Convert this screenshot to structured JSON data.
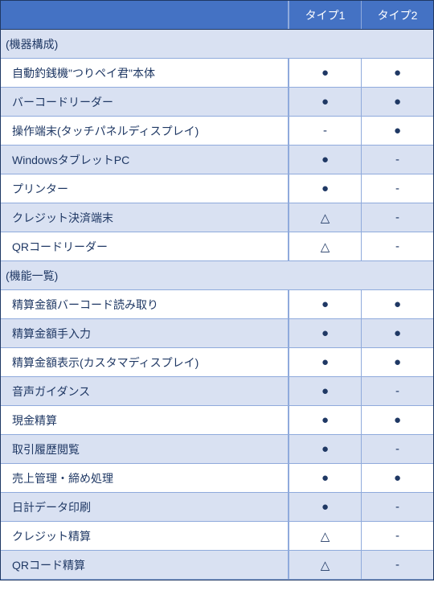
{
  "chart_data": {
    "type": "table",
    "columns": [
      "タイプ1",
      "タイプ2"
    ],
    "sections": [
      {
        "title": "(機器構成)",
        "rows": [
          {
            "label": "自動釣銭機\"つりペイ君\"本体",
            "values": [
              "●",
              "●"
            ]
          },
          {
            "label": "バーコードリーダー",
            "values": [
              "●",
              "●"
            ]
          },
          {
            "label": "操作端末(タッチパネルディスプレイ)",
            "values": [
              "-",
              "●"
            ]
          },
          {
            "label": "WindowsタブレットPC",
            "values": [
              "●",
              "-"
            ]
          },
          {
            "label": "プリンター",
            "values": [
              "●",
              "-"
            ]
          },
          {
            "label": "クレジット決済端末",
            "values": [
              "△",
              "-"
            ]
          },
          {
            "label": "QRコードリーダー",
            "values": [
              "△",
              "-"
            ]
          }
        ]
      },
      {
        "title": "(機能一覧)",
        "rows": [
          {
            "label": "精算金額バーコード読み取り",
            "values": [
              "●",
              "●"
            ]
          },
          {
            "label": "精算金額手入力",
            "values": [
              "●",
              "●"
            ]
          },
          {
            "label": "精算金額表示(カスタマディスプレイ)",
            "values": [
              "●",
              "●"
            ]
          },
          {
            "label": "音声ガイダンス",
            "values": [
              "●",
              "-"
            ]
          },
          {
            "label": "現金精算",
            "values": [
              "●",
              "●"
            ]
          },
          {
            "label": "取引履歴閲覧",
            "values": [
              "●",
              "-"
            ]
          },
          {
            "label": "売上管理・締め処理",
            "values": [
              "●",
              "●"
            ]
          },
          {
            "label": "日計データ印刷",
            "values": [
              "●",
              "-"
            ]
          },
          {
            "label": "クレジット精算",
            "values": [
              "△",
              "-"
            ]
          },
          {
            "label": "QRコード精算",
            "values": [
              "△",
              "-"
            ]
          }
        ]
      }
    ]
  }
}
